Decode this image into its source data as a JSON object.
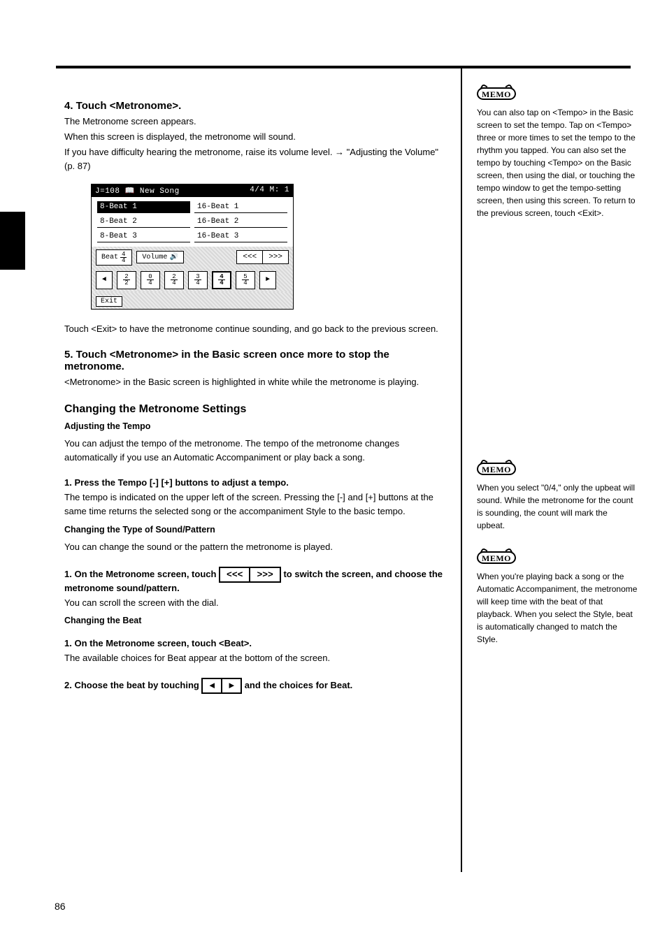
{
  "footer_page": "86",
  "main": {
    "intro_step": "4. Touch <Metronome>.",
    "intro_body_1": "The Metronome screen appears.",
    "intro_body_2": "When this screen is displayed, the metronome will sound.",
    "intro_body_3": "If you have difficulty hearing the metronome, raise its volume level. → \"Adjusting the Volume\" (p. 87)",
    "exit_note": "Touch <Exit> to have the metronome continue sounding, and go back to the previous screen.",
    "stop_step": "5. Touch <Metronome> in the Basic screen once more to stop the metronome.",
    "step4_after": "<Metronome> in the Basic screen is highlighted in white while the metronome is playing.",
    "change_heading": "Changing the Metronome Settings",
    "tempo_head": "Adjusting the Tempo",
    "tempo_body": "You can adjust the tempo of the metronome. The tempo of the metronome changes automatically if you use an Automatic Accompaniment or play back a song.",
    "tempo_step_a": "1. Press the Tempo [-] [+] buttons to adjust a tempo.",
    "tempo_body2": "The tempo is indicated on the upper left of the screen. Pressing the [-] and [+] buttons at the same time returns the selected song or the accompaniment Style to the basic tempo.",
    "pattern_head": "Changing the Type of Sound/Pattern",
    "pattern_body": "You can change the sound or the pattern the metronome is played.",
    "pattern_step_a": "1. On the Metronome screen, touch           to switch the screen, and choose the metronome sound/pattern.",
    "pattern_body2": "You can scroll the screen with the dial.",
    "beat_head": "Changing the Beat",
    "beat_step_a": "1. On the Metronome screen, touch <Beat>.",
    "beat_body_a": "The available choices for Beat appear at the bottom of the screen.",
    "beat_step_b": "2. Choose the beat by touching           and the choices for Beat."
  },
  "lcd": {
    "tempo": "J=108",
    "title": "New Song",
    "timesig_header": "4/4  M:   1",
    "col1": [
      "8-Beat 1",
      "8-Beat 2",
      "8-Beat 3"
    ],
    "col2": [
      "16-Beat 1",
      "16-Beat 2",
      "16-Beat 3"
    ],
    "selected_item": "8-Beat 1",
    "beat_label": "Beat",
    "beat_value_top": "4",
    "beat_value_bot": "4",
    "volume_label": "Volume",
    "nav_left": "<<<",
    "nav_right": ">>>",
    "ts_options": [
      [
        "2",
        "2"
      ],
      [
        "0",
        "4"
      ],
      [
        "2",
        "4"
      ],
      [
        "3",
        "4"
      ],
      [
        "4",
        "4"
      ],
      [
        "5",
        "4"
      ]
    ],
    "ts_selected": "4/4",
    "arrow_left": "◄",
    "arrow_right": "►",
    "exit_label": "Exit"
  },
  "side": {
    "memo_label": "MEMO",
    "memo1": "You can also tap on <Tempo> in the Basic screen to set the tempo. Tap on <Tempo> three or more times to set the tempo to the rhythm you tapped. You can also set the tempo by touching <Tempo> on the Basic screen, then using the dial, or touching the tempo window to get the tempo-setting screen, then using this screen. To return to the previous screen, touch <Exit>.",
    "memo2": "When you select \"0/4,\" only the upbeat will sound. While the metronome for the count is sounding, the count will mark the upbeat.",
    "memo3": "When you're playing back a song or the Automatic Accompaniment, the metronome will keep time with the beat of that playback. When you select the Style, beat is automatically changed to match the Style."
  },
  "inline_nav": {
    "left_dbl": "<<<",
    "right_dbl": ">>>",
    "left_s": "◄",
    "right_s": "►"
  }
}
